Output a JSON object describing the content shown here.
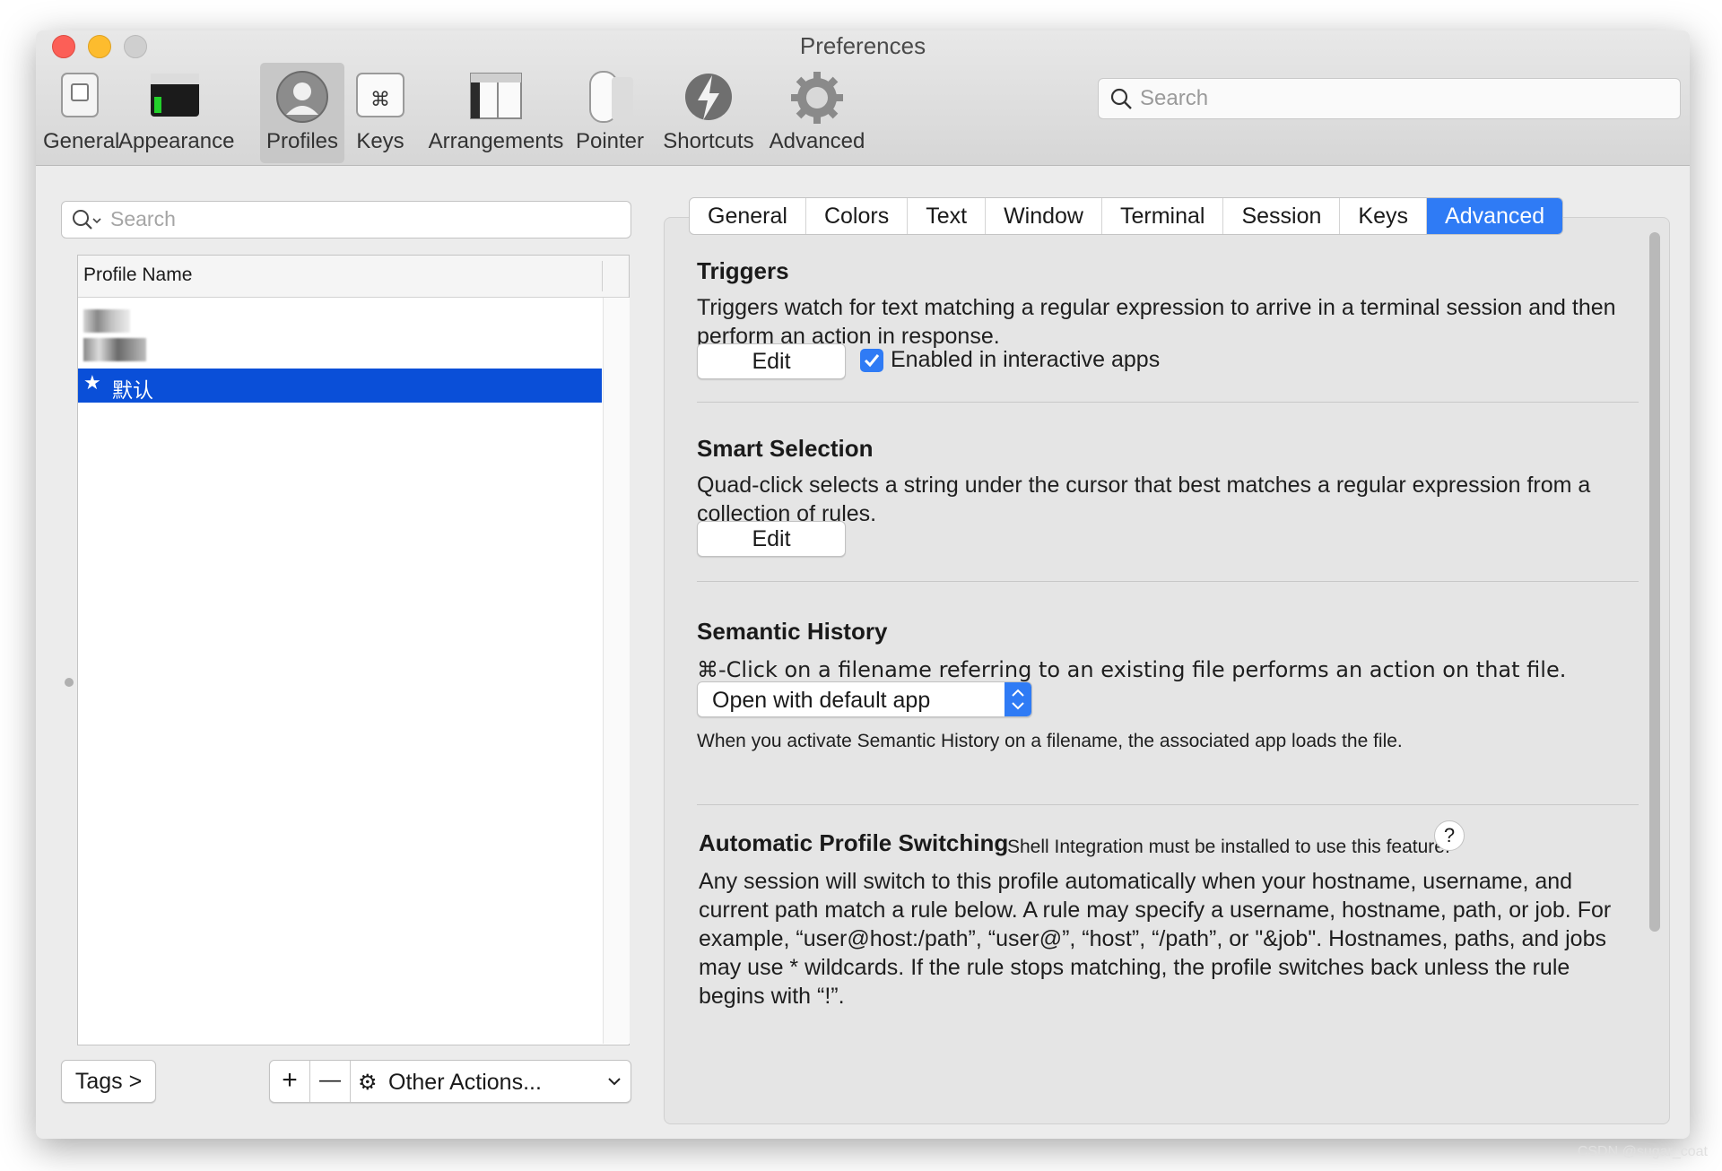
{
  "window": {
    "title": "Preferences"
  },
  "toolbar": {
    "items": [
      {
        "label": "General",
        "icon": "general-switch-icon"
      },
      {
        "label": "Appearance",
        "icon": "appearance-terminal-icon"
      },
      {
        "label": "Profiles",
        "icon": "person-silhouette-icon",
        "active": true
      },
      {
        "label": "Keys",
        "icon": "command-key-icon"
      },
      {
        "label": "Arrangements",
        "icon": "window-arrangement-icon"
      },
      {
        "label": "Pointer",
        "icon": "mouse-icon"
      },
      {
        "label": "Shortcuts",
        "icon": "lightning-bolt-icon"
      },
      {
        "label": "Advanced",
        "icon": "gear-icon"
      }
    ],
    "search_placeholder": "Search"
  },
  "profiles": {
    "search_placeholder": "Search",
    "column_header": "Profile Name",
    "rows": [
      {
        "label": "",
        "blurred": true
      },
      {
        "label": "",
        "blurred": true
      },
      {
        "label": "默认",
        "starred": true,
        "selected": true
      }
    ],
    "tags_button": "Tags >",
    "add_button": "+",
    "remove_button": "—",
    "other_actions": "Other Actions..."
  },
  "tabs": [
    "General",
    "Colors",
    "Text",
    "Window",
    "Terminal",
    "Session",
    "Keys",
    "Advanced"
  ],
  "active_tab": "Advanced",
  "triggers": {
    "title": "Triggers",
    "desc": "Triggers watch for text matching a regular expression to arrive in a terminal session and then perform an action in response.",
    "edit": "Edit",
    "checkbox_label": "Enabled in interactive apps",
    "checked": true
  },
  "smart_selection": {
    "title": "Smart Selection",
    "desc": "Quad-click selects a string under the cursor that best matches a regular expression from a collection of rules.",
    "edit": "Edit"
  },
  "semantic_history": {
    "title": "Semantic History",
    "desc": "⌘-Click on a filename referring to an existing file performs an action on that file.",
    "selected": "Open with default app",
    "note": "When you activate Semantic History on a filename, the associated app loads the file."
  },
  "auto_switching": {
    "title": "Automatic Profile Switching",
    "note": "Shell Integration must be installed to use this feature.",
    "help": "?",
    "desc": "Any session will switch to this profile automatically when your hostname, username, and current path match a rule below. A rule may specify a username, hostname, path, or job. For example, “user@host:/path”, “user@”, “host”, “/path”, or \"&job\". Hostnames, paths, and jobs may use * wildcards. If the rule stops matching, the profile switches back unless the rule begins with “!”."
  },
  "watermark": "CSDN @sugar_coat",
  "colors": {
    "accent": "#2f7bf5",
    "selection": "#0a4fd8"
  }
}
